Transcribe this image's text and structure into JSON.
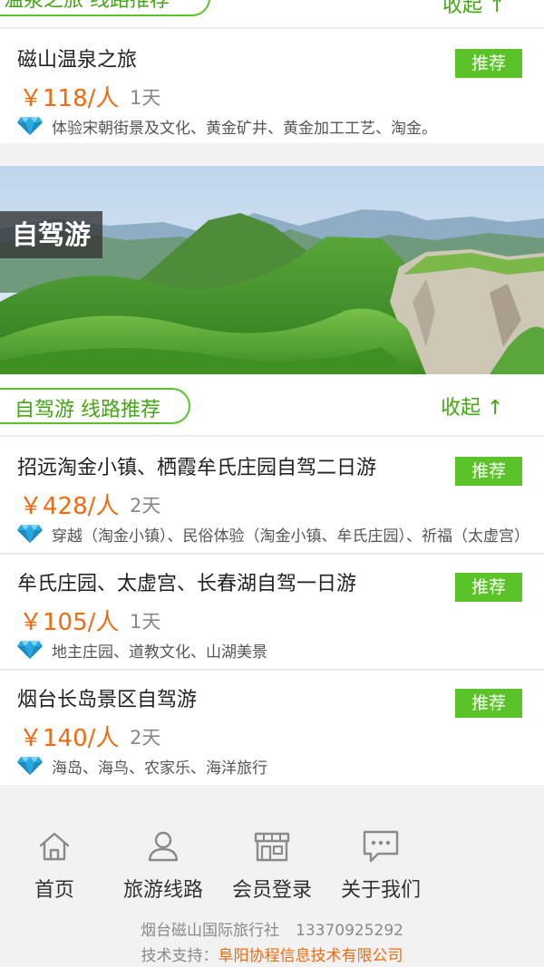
{
  "top_section": {
    "title": "温泉之旅 线路推荐",
    "collapse_label": "收起 ↑"
  },
  "hot_spring_routes": [
    {
      "name": "磁山温泉之旅",
      "badge": "推荐",
      "price": "￥118/人",
      "days": "1天",
      "features": "体验宋朝街景及文化、黄金矿井、黄金加工工艺、淘金。"
    }
  ],
  "banner": {
    "tag": "自驾游"
  },
  "drive_section": {
    "title": "自驾游 线路推荐",
    "collapse_label": "收起 ↑"
  },
  "drive_routes": [
    {
      "name": "招远淘金小镇、栖霞牟氏庄园自驾二日游",
      "badge": "推荐",
      "price": "￥428/人",
      "days": "2天",
      "features": "穿越（淘金小镇）、民俗体验（淘金小镇、牟氏庄园）、祈福（太虚宫）"
    },
    {
      "name": "牟氏庄园、太虚宫、长春湖自驾一日游",
      "badge": "推荐",
      "price": "￥105/人",
      "days": "1天",
      "features": "地主庄园、道教文化、山湖美景"
    },
    {
      "name": "烟台长岛景区自驾游",
      "badge": "推荐",
      "price": "￥140/人",
      "days": "2天",
      "features": "海岛、海鸟、农家乐、海洋旅行"
    }
  ],
  "nav": [
    {
      "label": "首页",
      "icon": "home-icon"
    },
    {
      "label": "旅游线路",
      "icon": "user-icon"
    },
    {
      "label": "会员登录",
      "icon": "store-icon"
    },
    {
      "label": "关于我们",
      "icon": "message-icon"
    }
  ],
  "footer": {
    "company": "烟台磁山国际旅行社",
    "phone": "13370925292",
    "tech_label": "技术支持：",
    "tech_company": "阜阳协程信息技术有限公司"
  },
  "colors": {
    "accent_green": "#5cc22a",
    "price_orange": "#f06a0f",
    "gem_blue": "#2aa9e0"
  }
}
